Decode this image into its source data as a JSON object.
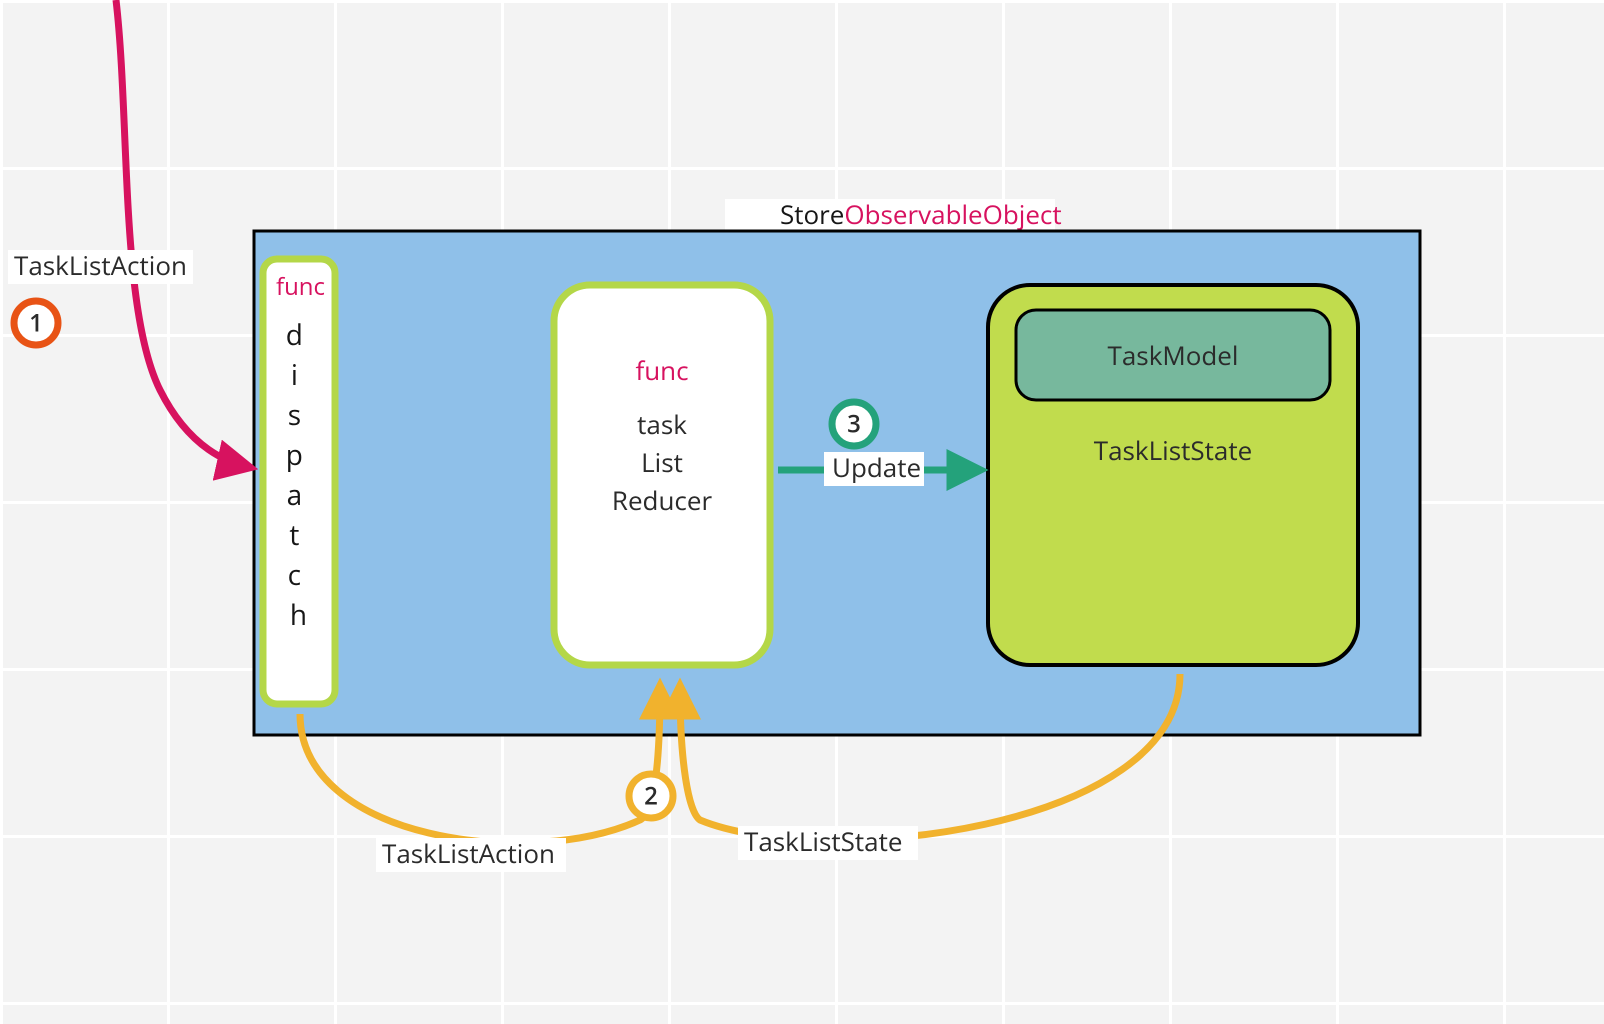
{
  "title": {
    "store": "Store",
    "observable": "ObservableObject"
  },
  "external": {
    "action_label": "TaskListAction"
  },
  "boxes": {
    "dispatch": {
      "keyword": "func",
      "name": "dispatch"
    },
    "reducer": {
      "keyword": "func",
      "name_line1": "task",
      "name_line2": "List",
      "name_line3": "Reducer"
    },
    "state": {
      "inner": "TaskModel",
      "outer": "TaskListState"
    }
  },
  "steps": {
    "s1": "1",
    "s2": "2",
    "s3": "3"
  },
  "edges": {
    "update": "Update",
    "to_reducer_left": "TaskListAction",
    "to_reducer_right": "TaskListState"
  },
  "colors": {
    "pink": "#d7125f",
    "orange": "#e85315",
    "yellow": "#f1b22d",
    "teal": "#24a27b"
  }
}
